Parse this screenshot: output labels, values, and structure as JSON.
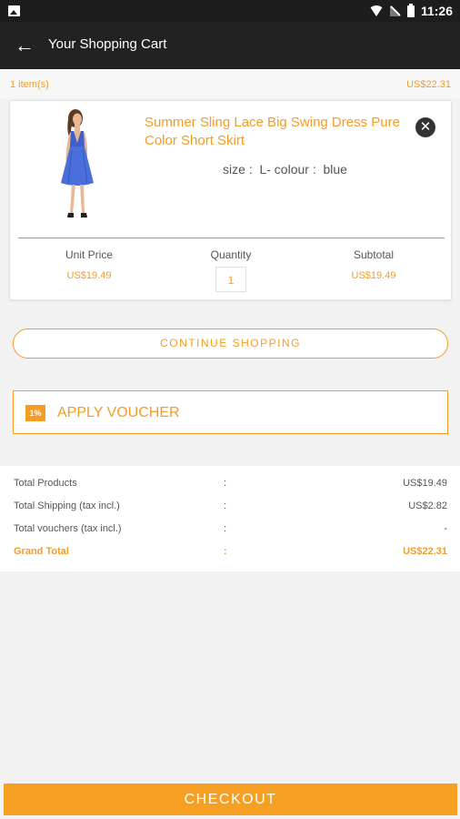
{
  "status_bar": {
    "time": "11:26"
  },
  "app_bar": {
    "back_icon": "arrow-left-icon",
    "title": "Your Shopping Cart"
  },
  "summary": {
    "item_count": "1 item(s)",
    "total": "US$22.31"
  },
  "cart": {
    "items": [
      {
        "name": "Summer Sling Lace Big Swing Dress Pure Color Short Skirt",
        "attributes": "size :  L- colour :  blue",
        "unit_price_label": "Unit Price",
        "unit_price": "US$19.49",
        "quantity_label": "Quantity",
        "quantity": "1",
        "subtotal_label": "Subtotal",
        "subtotal": "US$19.49",
        "remove_icon": "close-circle-icon"
      }
    ]
  },
  "actions": {
    "continue_label": "CONTINUE SHOPPING",
    "voucher_label": "APPLY VOUCHER",
    "voucher_icon_text": "1%"
  },
  "totals": {
    "rows": [
      {
        "label": "Total Products",
        "colon": ":",
        "value": "US$19.49"
      },
      {
        "label": "Total Shipping (tax incl.)",
        "colon": ":",
        "value": "US$2.82"
      },
      {
        "label": "Total vouchers (tax incl.)",
        "colon": ":",
        "value": "-"
      },
      {
        "label": "Grand Total",
        "colon": ":",
        "value": "US$22.31"
      }
    ]
  },
  "checkout": {
    "label": "CHECKOUT"
  },
  "colors": {
    "accent": "#f39c26",
    "app_bar": "#222222",
    "checkout_bg": "#f5a023"
  }
}
